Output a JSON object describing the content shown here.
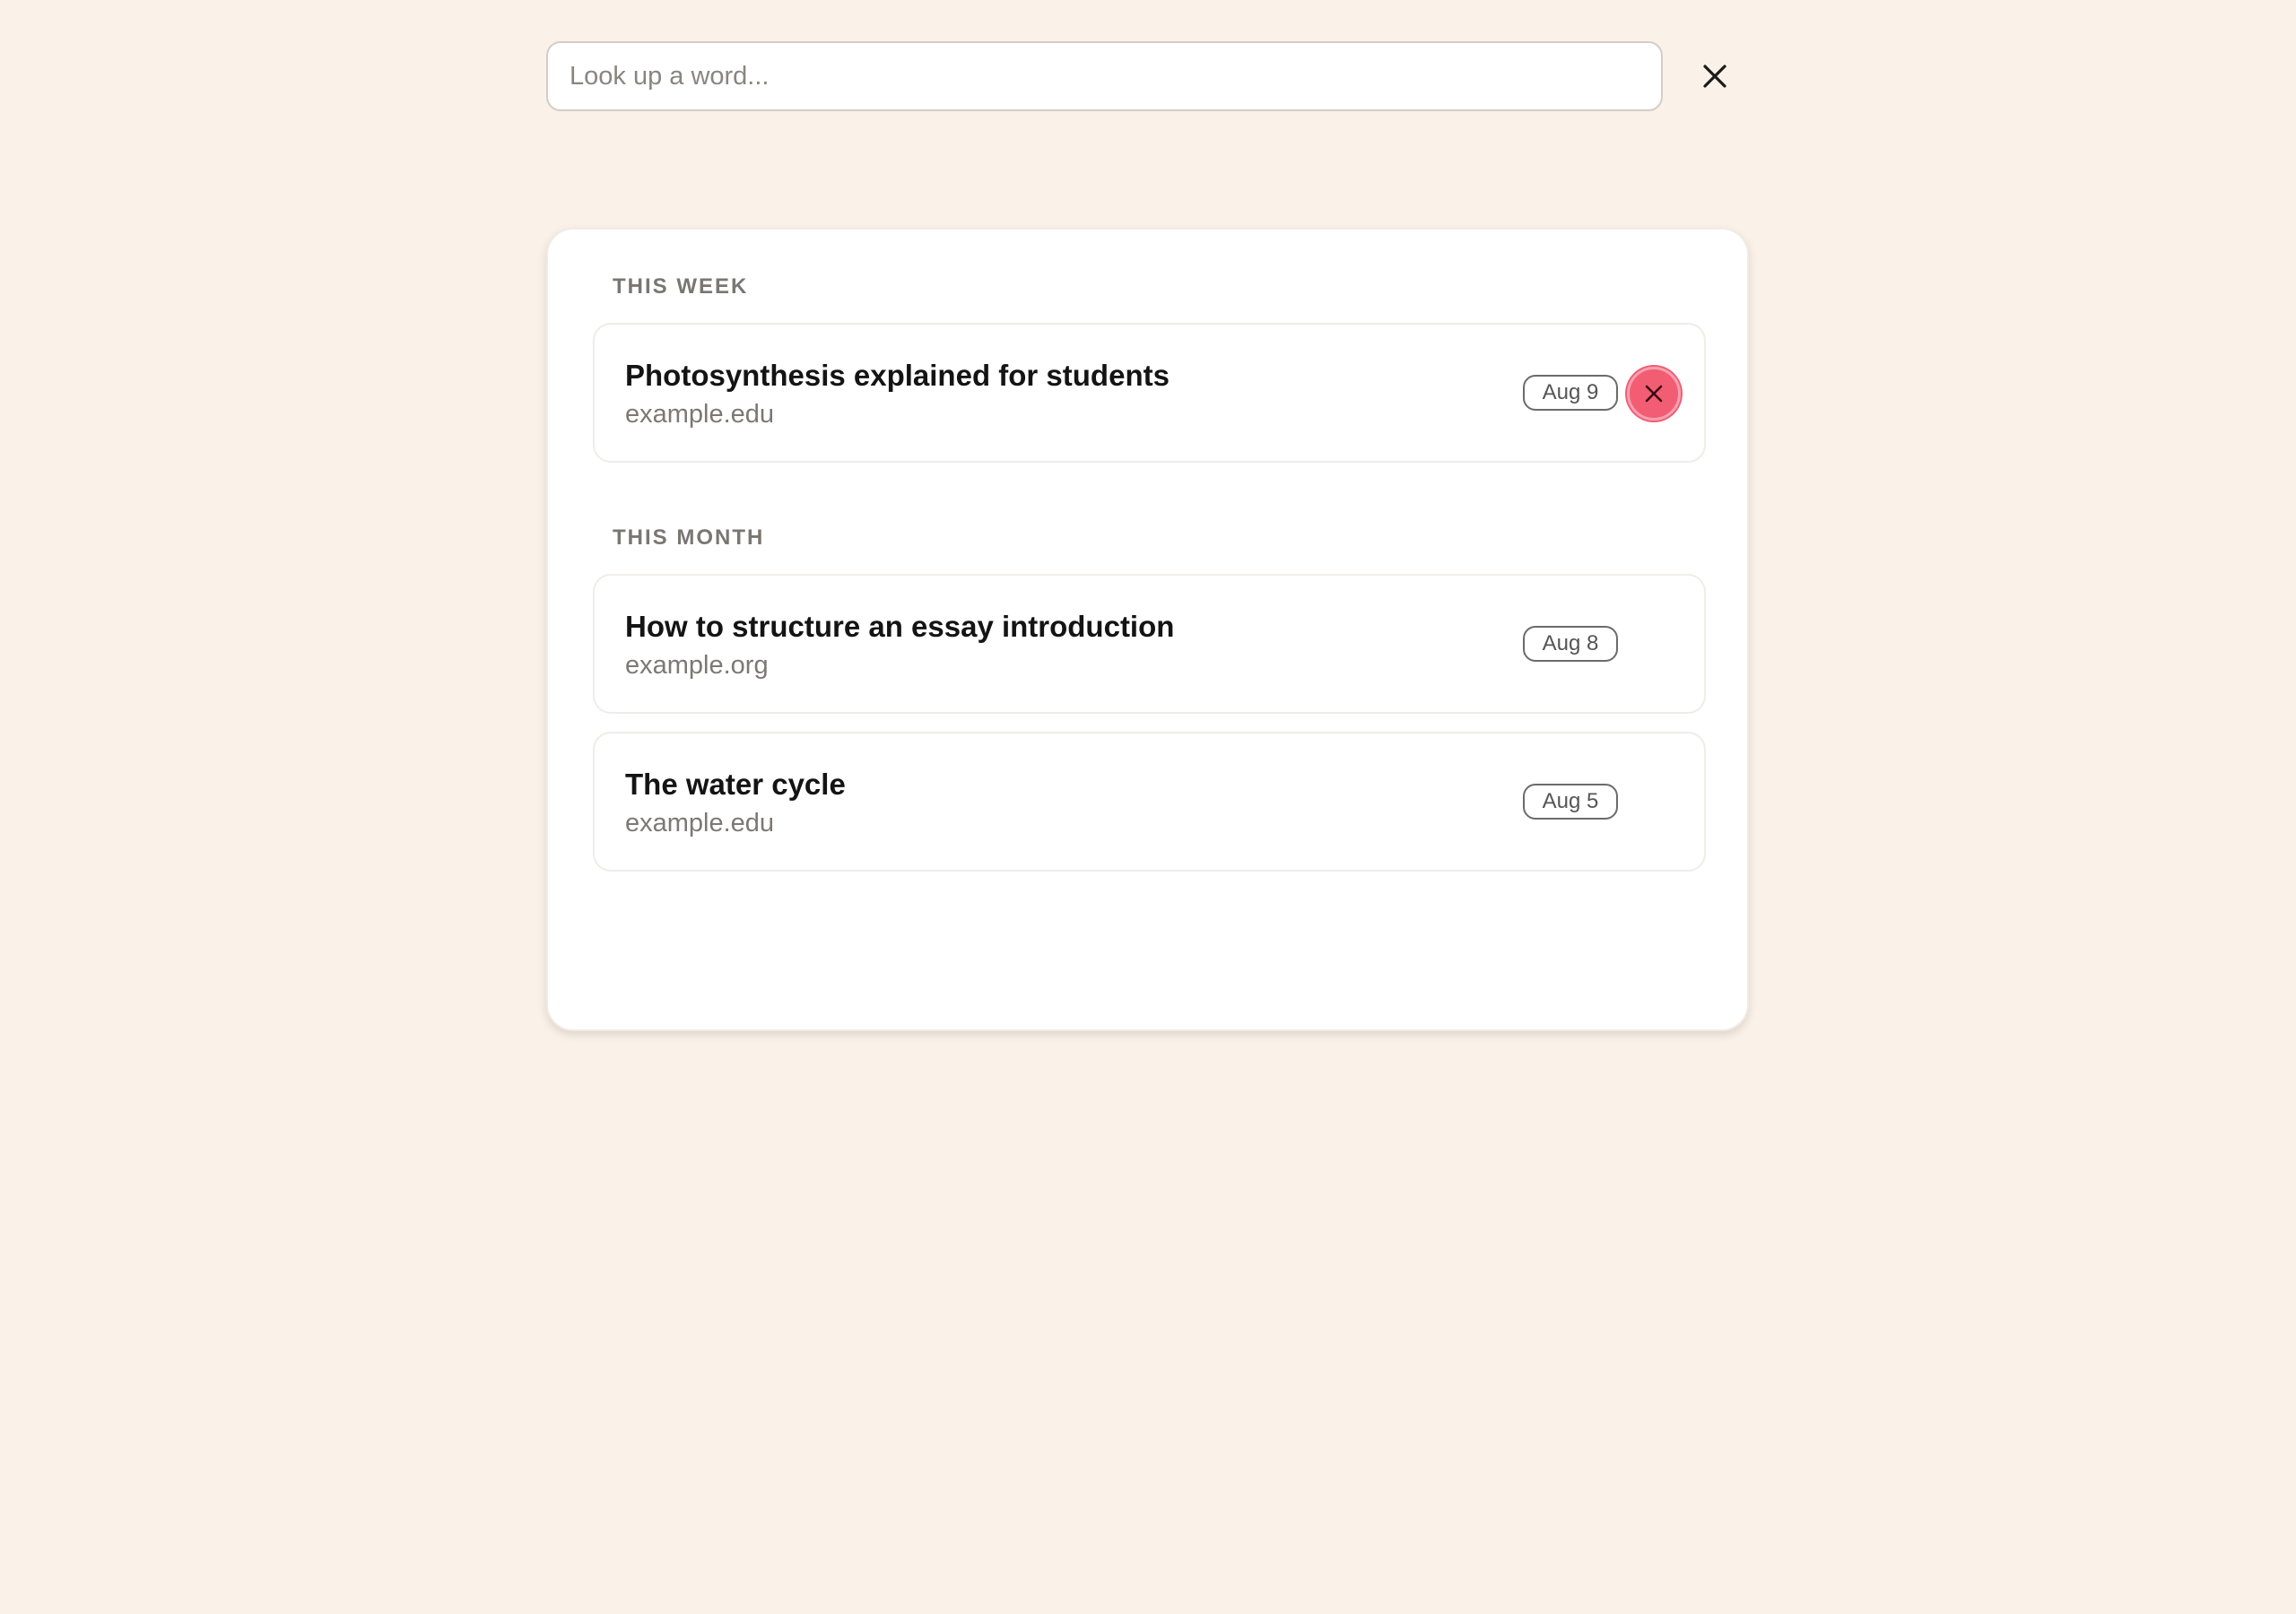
{
  "search": {
    "placeholder": "Look up a word...",
    "value": "",
    "close_icon": "close-icon"
  },
  "history": {
    "sections": [
      {
        "heading": "THIS WEEK",
        "items": [
          {
            "title": "Photosynthesis explained for students",
            "domain": "example.edu",
            "date": "Aug 9",
            "delete_icon": "close-icon",
            "delete_visible": true
          }
        ]
      },
      {
        "heading": "THIS MONTH",
        "items": [
          {
            "title": "How to structure an essay introduction",
            "domain": "example.org",
            "date": "Aug 8"
          },
          {
            "title": "The water cycle",
            "domain": "example.edu",
            "date": "Aug 5"
          }
        ]
      }
    ]
  },
  "colors": {
    "background": "#faf1e8",
    "delete_accent": "#f25d74"
  }
}
